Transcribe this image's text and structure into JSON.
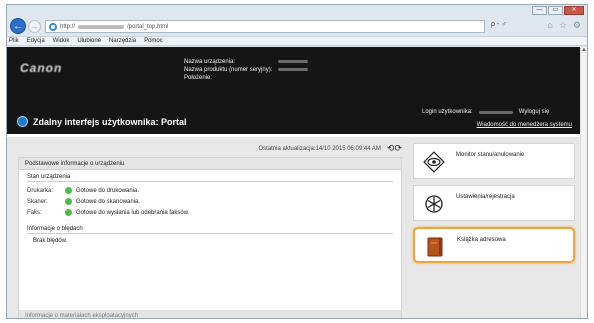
{
  "window": {
    "controls": [
      "—",
      "▭",
      "✕"
    ]
  },
  "address": {
    "protocol": "http://",
    "path": "/portal_top.html",
    "tools": "ρ - ♂"
  },
  "menu": [
    "Plik",
    "Edycja",
    "Widok",
    "Ulubione",
    "Narzędzia",
    "Pomoc"
  ],
  "header": {
    "logo": "Canon",
    "device_name_label": "Nazwa urządzenia:",
    "product_name_label": "Nazwa produktu (numer seryjny):",
    "location_label": "Położenie:",
    "login_label": "Login użytkownika:",
    "logout": "Wyloguj się",
    "message_link": "Wiadomość do menedżera systemu",
    "portal_title": "Zdalny interfejs użytkownika: Portal"
  },
  "main": {
    "last_update": "Ostatnia aktualizacja:14/10 2015 06:09:44 AM",
    "basic_info_header": "Podstawowe informacje o urządzeniu",
    "device_state_title": "Stan urządzenia",
    "status": [
      {
        "key": "Drukarka:",
        "value": "Gotowe do drukowania."
      },
      {
        "key": "Skaner:",
        "value": "Gotowe do skanowania."
      },
      {
        "key": "Faks:",
        "value": "Gotowe do wysłania lub odebrania faksów."
      }
    ],
    "error_title": "Informacje o błędach",
    "error_value": "Brak błędów.",
    "consumables_header": "Informacje o materiałach eksploatacyjnych"
  },
  "menu_cards": [
    {
      "label": "Monitor stanu/anulowanie",
      "icon": "monitor-eye-icon"
    },
    {
      "label": "Ustawienia/rejestracja",
      "icon": "settings-asterisk-icon"
    },
    {
      "label": "Książka adresowa",
      "icon": "address-book-icon"
    }
  ],
  "colors": {
    "header_bg": "#151515",
    "selected_border": "#f0a53a",
    "status_ok": "#4cba46"
  }
}
